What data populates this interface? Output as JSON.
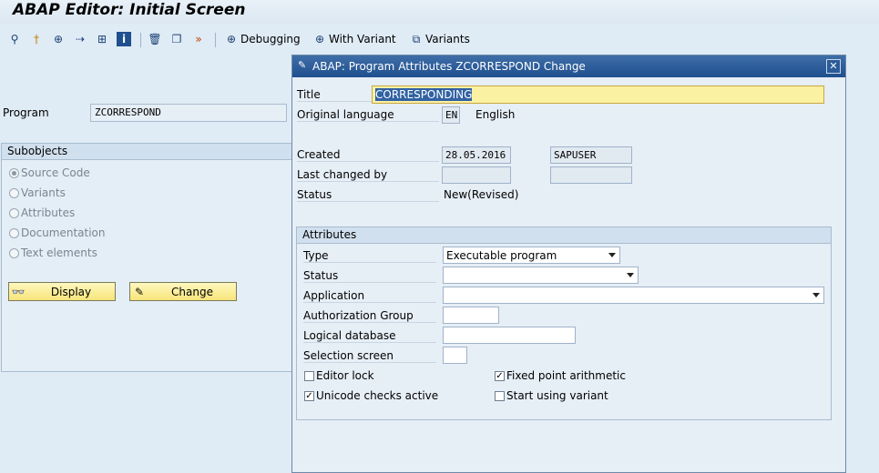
{
  "window": {
    "title": "ABAP Editor: Initial Screen"
  },
  "toolbar": {
    "debugging_label": "Debugging",
    "with_variant_label": "With Variant",
    "variants_label": "Variants"
  },
  "main": {
    "program_label": "Program",
    "program_value": "ZCORRESPOND",
    "subobjects_title": "Subobjects",
    "subobjects": [
      {
        "label": "Source Code",
        "selected": true
      },
      {
        "label": "Variants",
        "selected": false
      },
      {
        "label": "Attributes",
        "selected": false
      },
      {
        "label": "Documentation",
        "selected": false
      },
      {
        "label": "Text elements",
        "selected": false
      }
    ],
    "display_button": "Display",
    "change_button": "Change"
  },
  "dialog": {
    "title": "ABAP: Program Attributes ZCORRESPOND Change",
    "title_label": "Title",
    "title_value": "CORRESPONDING",
    "orig_lang_label": "Original language",
    "orig_lang_code": "EN",
    "orig_lang_name": "English",
    "created_label": "Created",
    "created_date": "28.05.2016",
    "created_user": "SAPUSER",
    "last_changed_label": "Last changed by",
    "last_changed_date": "",
    "last_changed_user": "",
    "status_label": "Status",
    "status_value": "New(Revised)",
    "attributes_title": "Attributes",
    "type_label": "Type",
    "type_value": "Executable program",
    "status2_label": "Status",
    "status2_value": "",
    "application_label": "Application",
    "application_value": "",
    "auth_group_label": "Authorization Group",
    "auth_group_value": "",
    "logical_db_label": "Logical database",
    "logical_db_value": "",
    "sel_screen_label": "Selection screen",
    "sel_screen_value": "",
    "editor_lock_label": "Editor lock",
    "editor_lock_checked": false,
    "fixed_point_label": "Fixed point arithmetic",
    "fixed_point_checked": true,
    "unicode_label": "Unicode checks active",
    "unicode_checked": true,
    "start_variant_label": "Start using variant",
    "start_variant_checked": false
  }
}
